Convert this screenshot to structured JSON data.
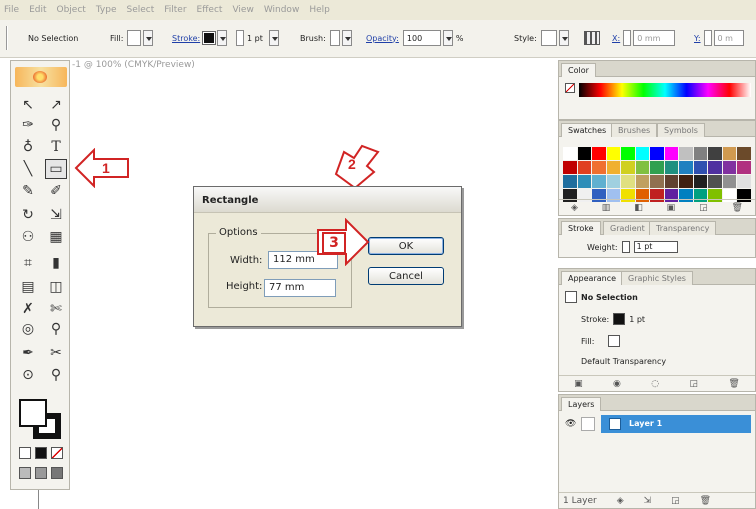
{
  "menubar": {
    "items": [
      "File",
      "Edit",
      "Object",
      "Type",
      "Select",
      "Filter",
      "Effect",
      "View",
      "Window",
      "Help"
    ]
  },
  "controlbar": {
    "selection": "No Selection",
    "fill_label": "Fill:",
    "stroke_label": "Stroke:",
    "stroke_weight": "1 pt",
    "brush_label": "Brush:",
    "opacity_label": "Opacity:",
    "opacity_value": "100",
    "percent": "%",
    "style_label": "Style:",
    "x_label": "X:",
    "x_value": "0 mm",
    "y_label": "Y:",
    "y_value": "0 m"
  },
  "document": {
    "title": "-1 @ 100% (CMYK/Preview)"
  },
  "tools": {
    "rows": [
      [
        "↖",
        "↗"
      ],
      [
        "✑",
        "⚲"
      ],
      [
        "♁",
        "T"
      ],
      [
        "╲",
        "▭"
      ],
      [
        "✎",
        "✐"
      ],
      [
        "↻",
        "⇲"
      ],
      [
        "⚇",
        "▦"
      ],
      [
        "⌗",
        "▮"
      ],
      [
        "▤",
        "◫"
      ],
      [
        "✗",
        "✄"
      ],
      [
        "◎",
        "⚲"
      ],
      [
        "✒",
        "✂"
      ],
      [
        "⊙",
        "⚲"
      ]
    ]
  },
  "callouts": {
    "one": "1",
    "two": "2",
    "three": "3"
  },
  "dialog": {
    "title": "Rectangle",
    "options_legend": "Options",
    "width_label": "Width:",
    "width_value": "112 mm",
    "height_label": "Height:",
    "height_value": "77 mm",
    "ok_label": "OK",
    "cancel_label": "Cancel"
  },
  "panels": {
    "color": {
      "tab": "Color"
    },
    "swatches": {
      "tabs": [
        "Swatches",
        "Brushes",
        "Symbols"
      ]
    },
    "stroke": {
      "tabs": [
        "Stroke",
        "Gradient",
        "Transparency"
      ],
      "weight_label": "Weight:",
      "weight_value": "1 pt"
    },
    "appearance": {
      "tabs": [
        "Appearance",
        "Graphic Styles"
      ],
      "header": "No Selection",
      "stroke_label": "Stroke:",
      "stroke_value": "1 pt",
      "fill_label": "Fill:",
      "default_transparency": "Default Transparency"
    },
    "layers": {
      "tab": "Layers",
      "layer_name": "Layer 1",
      "footer_count": "1 Layer"
    }
  },
  "colors": {
    "callout_red": "#d12424",
    "layer_highlight": "#3a8fd7",
    "swatch_grid": [
      "#ffffff",
      "#000000",
      "#ff0000",
      "#ffff00",
      "#00ff00",
      "#00ffff",
      "#0000ff",
      "#ff00ff",
      "#c0c0c0",
      "#808080",
      "#404040",
      "#d09a50",
      "#6b4a2a",
      "#c00000",
      "#e04020",
      "#f07030",
      "#f0b030",
      "#d0d020",
      "#80c040",
      "#30a050",
      "#209080",
      "#2080c0",
      "#3050b0",
      "#5030a0",
      "#8030a0",
      "#b03080",
      "#1e6e9e",
      "#2e8eb8",
      "#60b0d0",
      "#a0d0e0",
      "#e0e080",
      "#c0a060",
      "#907050",
      "#604030",
      "#402010",
      "#202020",
      "#505050",
      "#909090",
      "#e0e0e0",
      "#202020",
      "#f0f0f0",
      "#3060c0",
      "#a0c0f0",
      "#f0e000",
      "#e06000",
      "#c02020",
      "#6020a0",
      "#0080c0",
      "#00a080",
      "#80c000",
      "#ffffff",
      "#000000"
    ]
  }
}
